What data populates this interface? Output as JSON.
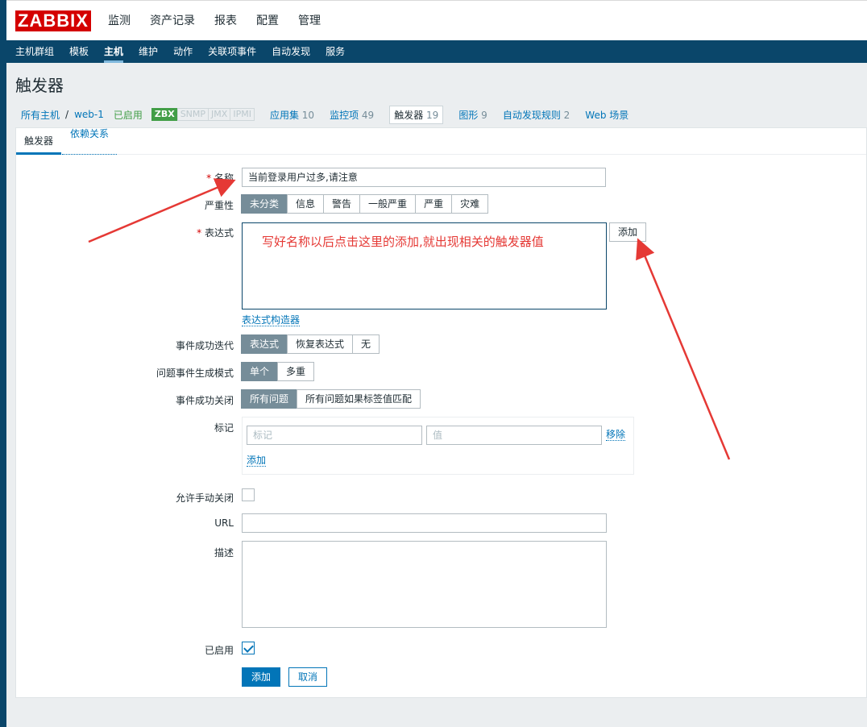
{
  "logo": "ZABBIX",
  "main_menu": [
    "监测",
    "资产记录",
    "报表",
    "配置",
    "管理"
  ],
  "sub_menu": [
    "主机群组",
    "模板",
    "主机",
    "维护",
    "动作",
    "关联项事件",
    "自动发现",
    "服务"
  ],
  "page_title": "触发器",
  "breadcrumb": {
    "all_hosts": "所有主机",
    "separator": "/",
    "host": "web-1",
    "status": "已启用",
    "badges": [
      "ZBX",
      "SNMP",
      "JMX",
      "IPMI"
    ],
    "applications": {
      "label": "应用集",
      "count": "10"
    },
    "items": {
      "label": "监控项",
      "count": "49"
    },
    "triggers": {
      "label": "触发器",
      "count": "19"
    },
    "graphs": {
      "label": "图形",
      "count": "9"
    },
    "discovery": {
      "label": "自动发现规则",
      "count": "2"
    },
    "web": "Web 场景"
  },
  "tabs": [
    "触发器",
    "依赖关系"
  ],
  "form": {
    "name_label": "名称",
    "name_value": "当前登录用户过多,请注意",
    "severity_label": "严重性",
    "severity_options": [
      "未分类",
      "信息",
      "警告",
      "一般严重",
      "严重",
      "灾难"
    ],
    "expression_label": "表达式",
    "add_button": "添加",
    "expression_builder": "表达式构造器",
    "ok_event_gen_label": "事件成功迭代",
    "ok_event_gen_options": [
      "表达式",
      "恢复表达式",
      "无"
    ],
    "problem_mode_label": "问题事件生成模式",
    "problem_mode_options": [
      "单个",
      "多重"
    ],
    "ok_close_label": "事件成功关闭",
    "ok_close_options": [
      "所有问题",
      "所有问题如果标签值匹配"
    ],
    "tags_label": "标记",
    "tag_placeholder": "标记",
    "value_placeholder": "值",
    "remove_link": "移除",
    "add_link": "添加",
    "manual_close_label": "允许手动关闭",
    "url_label": "URL",
    "description_label": "描述",
    "enabled_label": "已启用",
    "submit_button": "添加",
    "cancel_button": "取消"
  },
  "annotation": "写好名称以后点击这里的添加,就出现相关的触发器值",
  "annotation_color": "#e53935"
}
